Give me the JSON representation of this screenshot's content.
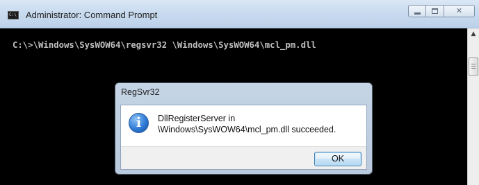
{
  "window": {
    "title": "Administrator: Command Prompt",
    "icon": "cmd-icon",
    "close_glyph": "✕"
  },
  "console": {
    "line": "C:\\>\\Windows\\SysWOW64\\regsvr32 \\Windows\\SysWOW64\\mcl_pm.dll",
    "scroll_up_glyph": "▲"
  },
  "dialog": {
    "title": "RegSvr32",
    "icon": "info-icon",
    "icon_glyph": "i",
    "message_line1": "DllRegisterServer in",
    "message_line2": "\\Windows\\SysWOW64\\mcl_pm.dll succeeded.",
    "ok_label": "OK"
  },
  "colors": {
    "console_bg": "#000000",
    "console_text": "#c0c0c0",
    "titlebar": "#c9dbef"
  }
}
